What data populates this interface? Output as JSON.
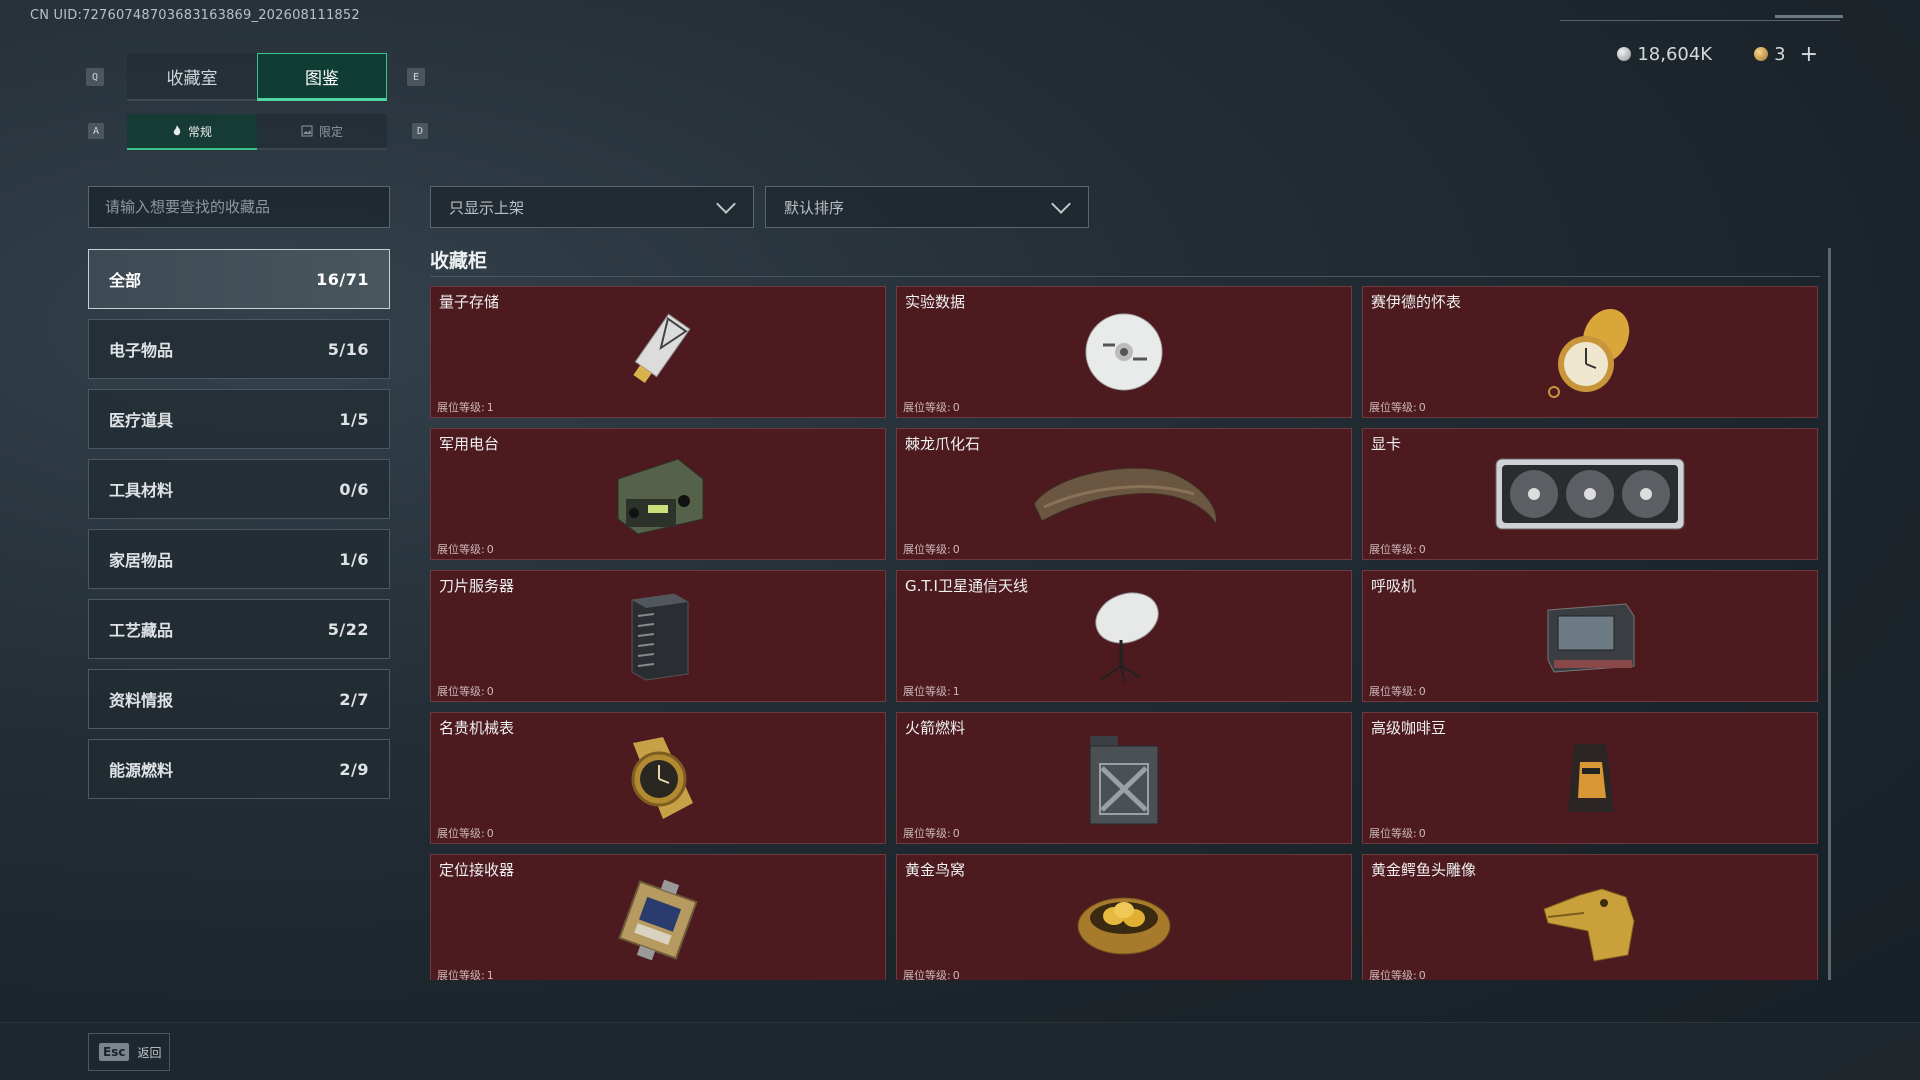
{
  "header": {
    "uid": "CN UID:7276074870368316386​9_202608111852",
    "silver": "18,604K",
    "gold": "3",
    "plus": "+"
  },
  "keys": {
    "q": "Q",
    "e": "E",
    "a": "A",
    "d": "D"
  },
  "tabs": [
    {
      "label": "收藏室"
    },
    {
      "label": "图鉴"
    }
  ],
  "subtabs": [
    {
      "label": "常规"
    },
    {
      "label": "限定"
    }
  ],
  "search": {
    "placeholder": "请输入想要查找的收藏品"
  },
  "filters": {
    "shelf": "只显示上架",
    "sort": "默认排序"
  },
  "categories": [
    {
      "label": "全部",
      "count": "16/71"
    },
    {
      "label": "电子物品",
      "count": "5/16"
    },
    {
      "label": "医疗道具",
      "count": "1/5"
    },
    {
      "label": "工具材料",
      "count": "0/6"
    },
    {
      "label": "家居物品",
      "count": "1/6"
    },
    {
      "label": "工艺藏品",
      "count": "5/22"
    },
    {
      "label": "资料情报",
      "count": "2/7"
    },
    {
      "label": "能源燃料",
      "count": "2/9"
    }
  ],
  "section": {
    "title": "收藏柜"
  },
  "level_label": "展位等级:",
  "items": [
    {
      "name": "量子存储",
      "level": "1",
      "icon": "usb-drive-icon"
    },
    {
      "name": "实验数据",
      "level": "0",
      "icon": "disc-icon"
    },
    {
      "name": "赛伊德的怀表",
      "level": "0",
      "icon": "pocket-watch-icon"
    },
    {
      "name": "军用电台",
      "level": "0",
      "icon": "military-radio-icon"
    },
    {
      "name": "棘龙爪化石",
      "level": "0",
      "icon": "claw-fossil-icon"
    },
    {
      "name": "显卡",
      "level": "0",
      "icon": "graphics-card-icon"
    },
    {
      "name": "刀片服务器",
      "level": "0",
      "icon": "server-icon"
    },
    {
      "name": "G.T.I卫星通信天线",
      "level": "1",
      "icon": "satellite-dish-icon"
    },
    {
      "name": "呼吸机",
      "level": "0",
      "icon": "ventilator-icon"
    },
    {
      "name": "名贵机械表",
      "level": "0",
      "icon": "wristwatch-icon"
    },
    {
      "name": "火箭燃料",
      "level": "0",
      "icon": "fuel-can-icon"
    },
    {
      "name": "高级咖啡豆",
      "level": "0",
      "icon": "coffee-bag-icon"
    },
    {
      "name": "定位接收器",
      "level": "1",
      "icon": "gps-receiver-icon"
    },
    {
      "name": "黄金鸟窝",
      "level": "0",
      "icon": "golden-nest-icon"
    },
    {
      "name": "黄金鳄鱼头雕像",
      "level": "0",
      "icon": "golden-croc-statue-icon"
    }
  ],
  "footer": {
    "esc_key": "Esc",
    "back": "返回"
  },
  "colors": {
    "accent": "#3fbf90",
    "card_bg": "#4d1a20",
    "bg": "#1f2830"
  }
}
